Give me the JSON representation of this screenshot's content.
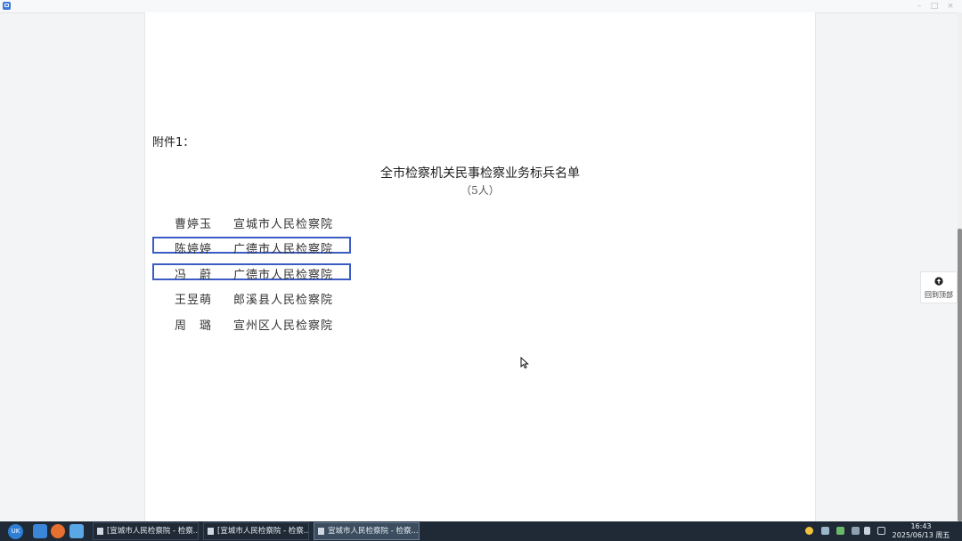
{
  "document": {
    "attachment_label": "附件1：",
    "title": "全市检察机关民事检察业务标兵名单",
    "subtitle": "（5人）",
    "entries": [
      {
        "name": "曹婷玉",
        "unit": "宣城市人民检察院",
        "highlighted": false
      },
      {
        "name": "陈婷婷",
        "unit": "广德市人民检察院",
        "highlighted": true
      },
      {
        "name": "冯　蔚",
        "unit": "广德市人民检察院",
        "highlighted": true
      },
      {
        "name": "王昱萌",
        "unit": "郎溪县人民检察院",
        "highlighted": false
      },
      {
        "name": "周　璐",
        "unit": "宣州区人民检察院",
        "highlighted": false
      }
    ],
    "highlight_color": "#3b5cc4"
  },
  "back_to_top": {
    "label": "回到顶部",
    "icon": "arrow-up-circle-icon"
  },
  "taskbar": {
    "tasks": [
      {
        "label": "[宣城市人民检察院 - 检察...",
        "active": false
      },
      {
        "label": "[宣城市人民检察院 - 检察...",
        "active": false
      },
      {
        "label": "宣城市人民检察院 - 检察...",
        "active": true
      }
    ],
    "clock_time": "16:43",
    "clock_date": "2025/06/13 周五"
  }
}
